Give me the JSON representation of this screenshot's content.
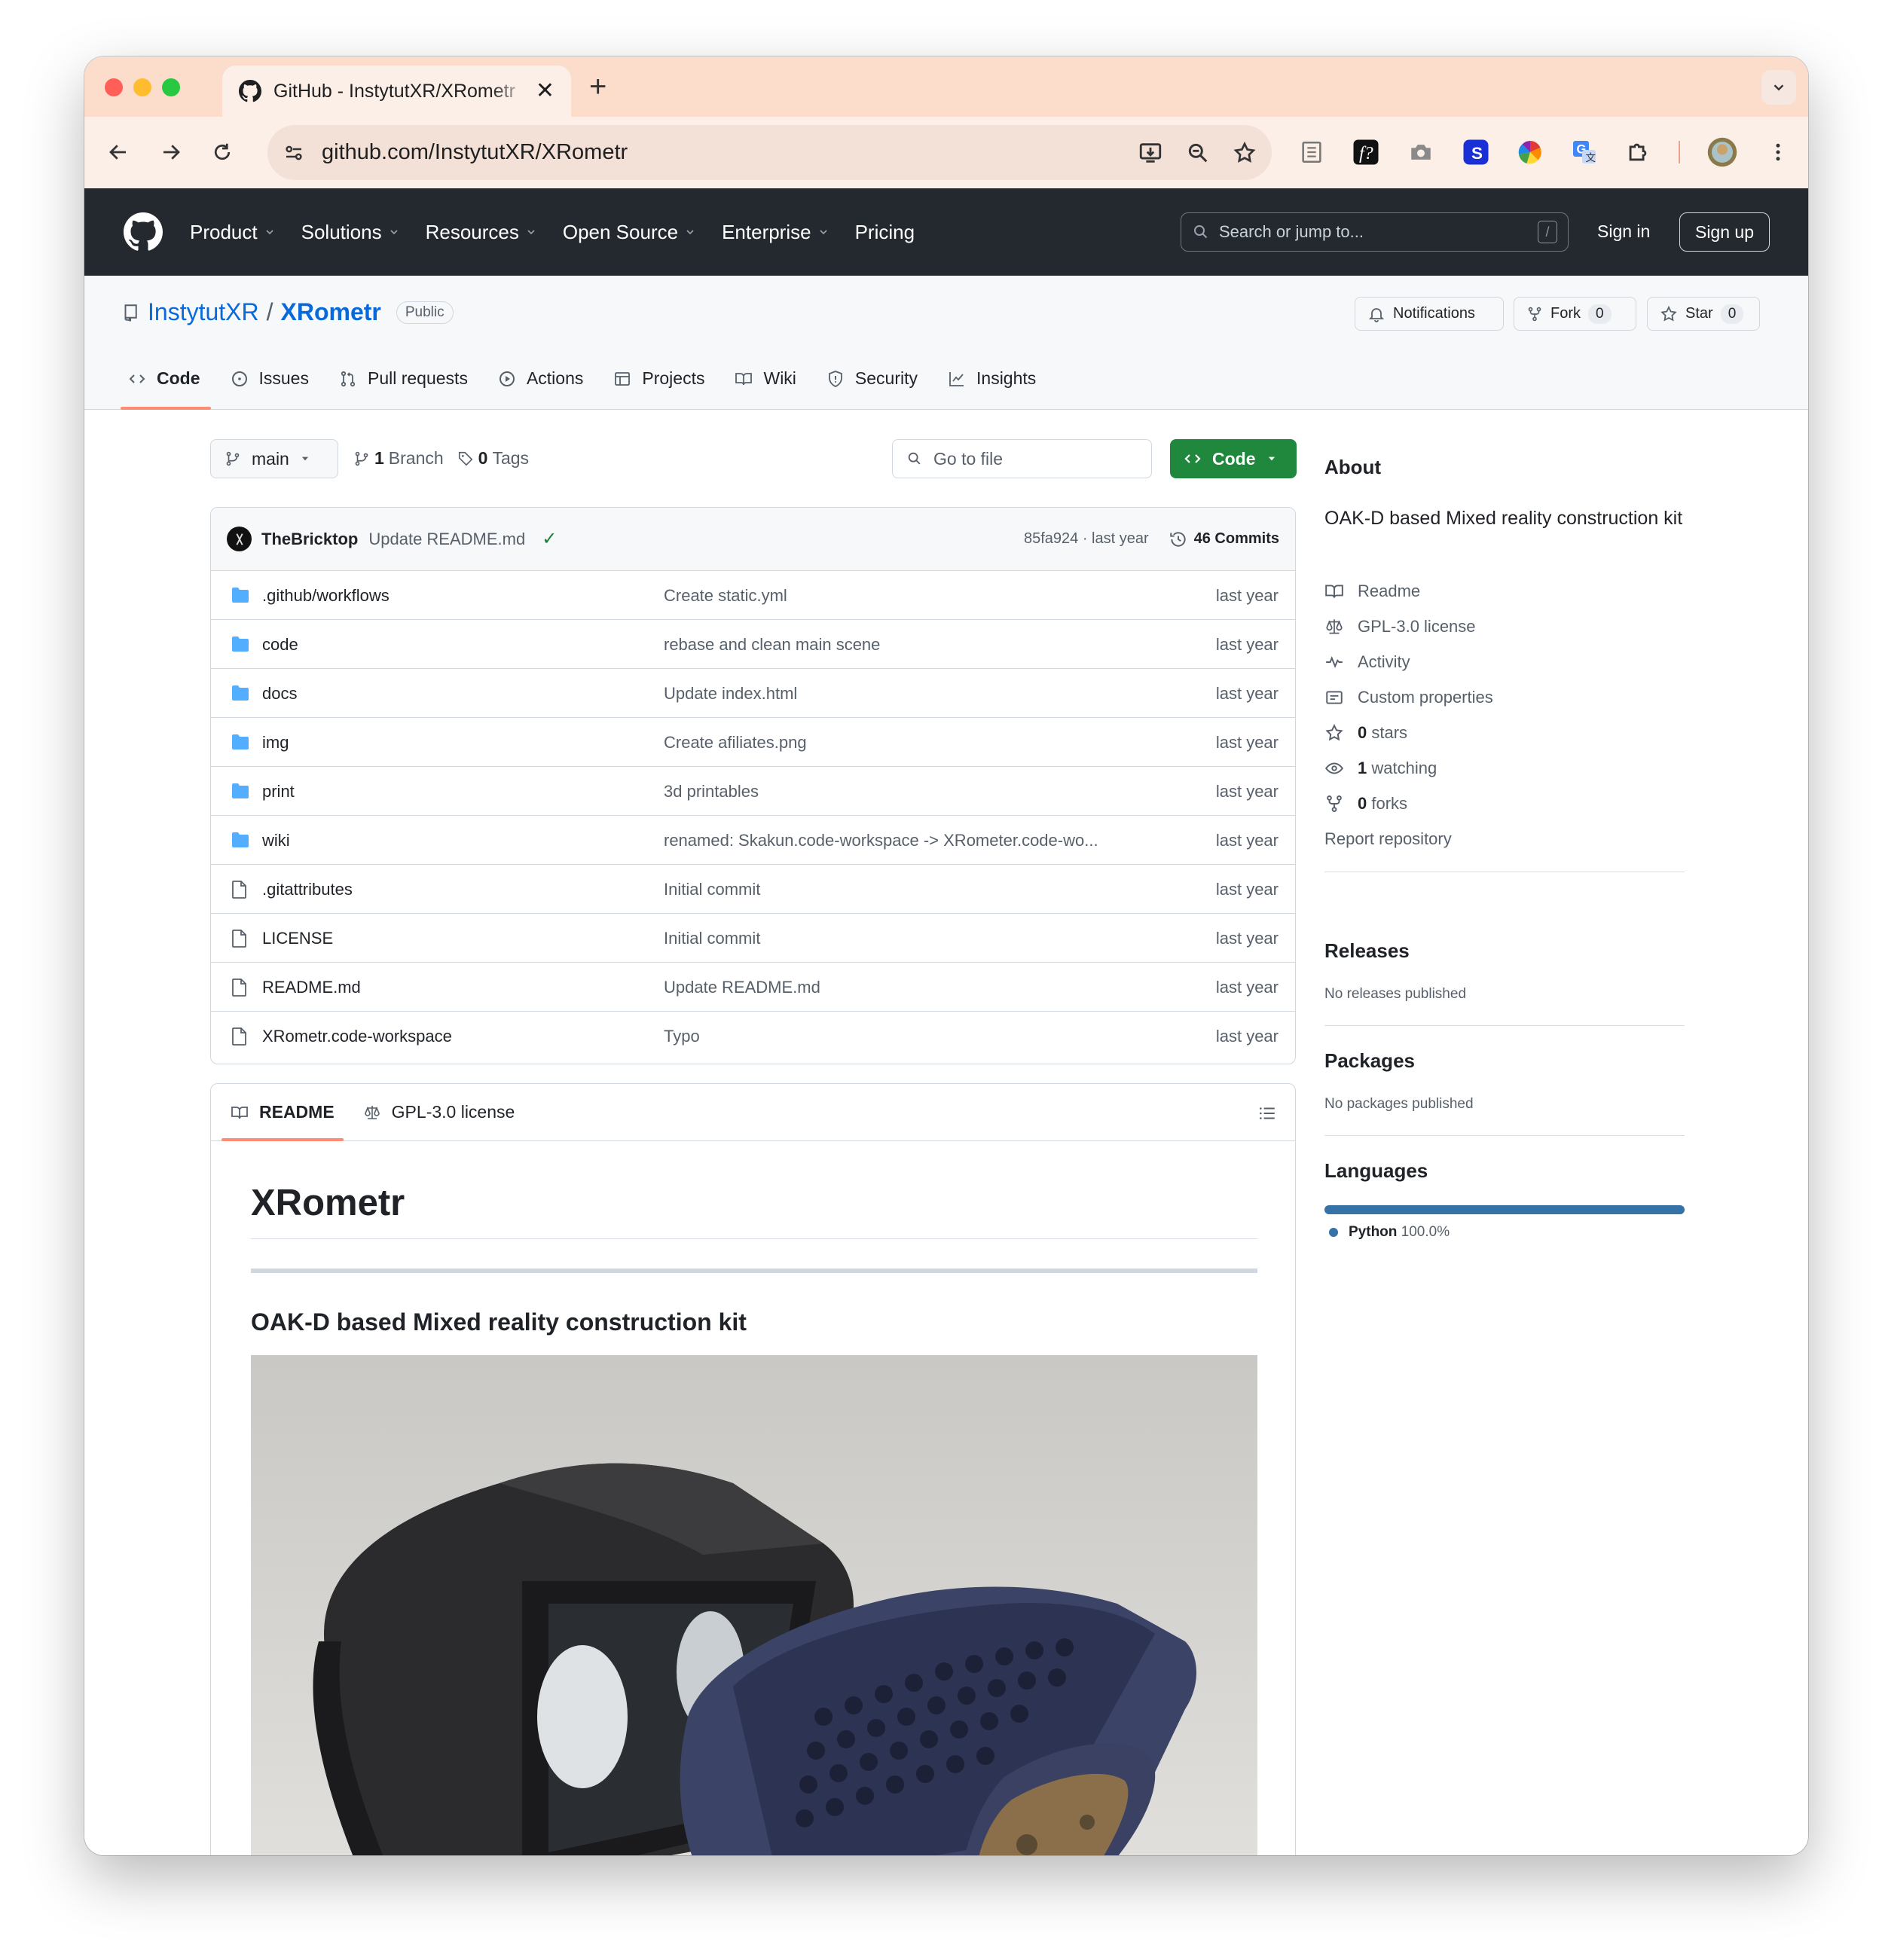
{
  "browser": {
    "tab_title": "GitHub - InstytutXR/XRometr",
    "tab_close": "✕",
    "new_tab": "+",
    "url": "github.com/InstytutXR/XRometr"
  },
  "gh_header": {
    "nav": [
      {
        "label": "Product",
        "dropdown": true
      },
      {
        "label": "Solutions",
        "dropdown": true
      },
      {
        "label": "Resources",
        "dropdown": true
      },
      {
        "label": "Open Source",
        "dropdown": true
      },
      {
        "label": "Enterprise",
        "dropdown": true
      },
      {
        "label": "Pricing",
        "dropdown": false
      }
    ],
    "search_placeholder": "Search or jump to...",
    "search_shortcut": "/",
    "sign_in": "Sign in",
    "sign_up": "Sign up"
  },
  "repo": {
    "owner": "InstytutXR",
    "separator": "/",
    "name": "XRometr",
    "visibility": "Public",
    "notifications_label": "Notifications",
    "fork_label": "Fork",
    "fork_count": "0",
    "star_label": "Star",
    "star_count": "0",
    "tabs": [
      {
        "label": "Code",
        "icon": "code-icon"
      },
      {
        "label": "Issues",
        "icon": "issue-icon"
      },
      {
        "label": "Pull requests",
        "icon": "pull-request-icon"
      },
      {
        "label": "Actions",
        "icon": "play-icon"
      },
      {
        "label": "Projects",
        "icon": "table-icon"
      },
      {
        "label": "Wiki",
        "icon": "book-icon"
      },
      {
        "label": "Security",
        "icon": "shield-icon"
      },
      {
        "label": "Insights",
        "icon": "graph-icon"
      }
    ]
  },
  "file_nav": {
    "branch": "main",
    "branch_count": "1",
    "branch_label": "Branch",
    "tag_count": "0",
    "tag_label": "Tags",
    "go_to_file": "Go to file",
    "code_button": "Code"
  },
  "latest_commit": {
    "author": "TheBricktop",
    "message": "Update README.md",
    "status": "✓",
    "sha_time": "85fa924 · last year",
    "commits": "46 Commits"
  },
  "files": [
    {
      "name": ".github/workflows",
      "type": "folder",
      "message": "Create static.yml",
      "date": "last year"
    },
    {
      "name": "code",
      "type": "folder",
      "message": "rebase and clean main scene",
      "date": "last year"
    },
    {
      "name": "docs",
      "type": "folder",
      "message": "Update index.html",
      "date": "last year"
    },
    {
      "name": "img",
      "type": "folder",
      "message": "Create afiliates.png",
      "date": "last year"
    },
    {
      "name": "print",
      "type": "folder",
      "message": "3d printables",
      "date": "last year"
    },
    {
      "name": "wiki",
      "type": "folder",
      "message": "renamed: Skakun.code-workspace -> XRometer.code-wo...",
      "date": "last year"
    },
    {
      "name": ".gitattributes",
      "type": "file",
      "message": "Initial commit",
      "date": "last year"
    },
    {
      "name": "LICENSE",
      "type": "file",
      "message": "Initial commit",
      "date": "last year"
    },
    {
      "name": "README.md",
      "type": "file",
      "message": "Update README.md",
      "date": "last year"
    },
    {
      "name": "XRometr.code-workspace",
      "type": "file",
      "message": "Typo",
      "date": "last year"
    }
  ],
  "readme": {
    "tab_readme": "README",
    "tab_license": "GPL-3.0 license",
    "h1": "XRometr",
    "h3": "OAK-D based Mixed reality construction kit"
  },
  "sidebar": {
    "about_heading": "About",
    "description": "OAK-D based Mixed reality construction kit",
    "links": [
      {
        "icon": "book-icon",
        "label": "Readme",
        "count": ""
      },
      {
        "icon": "law-icon",
        "label": "GPL-3.0 license",
        "count": ""
      },
      {
        "icon": "pulse-icon",
        "label": "Activity",
        "count": ""
      },
      {
        "icon": "note-icon",
        "label": "Custom properties",
        "count": ""
      },
      {
        "icon": "star-icon",
        "label": "stars",
        "count": "0"
      },
      {
        "icon": "eye-icon",
        "label": "watching",
        "count": "1"
      },
      {
        "icon": "fork-icon",
        "label": "forks",
        "count": "0"
      }
    ],
    "report": "Report repository",
    "releases_heading": "Releases",
    "releases_text": "No releases published",
    "packages_heading": "Packages",
    "packages_text": "No packages published",
    "languages_heading": "Languages",
    "language": "Python",
    "language_pct": "100.0%",
    "language_color": "#3572A5"
  },
  "colors": {
    "accent_blue": "#0969da",
    "header_bg": "#24292f",
    "code_button_green": "#1f883d",
    "tab_underline": "#fd8c73",
    "folder_blue": "#54aeff"
  }
}
